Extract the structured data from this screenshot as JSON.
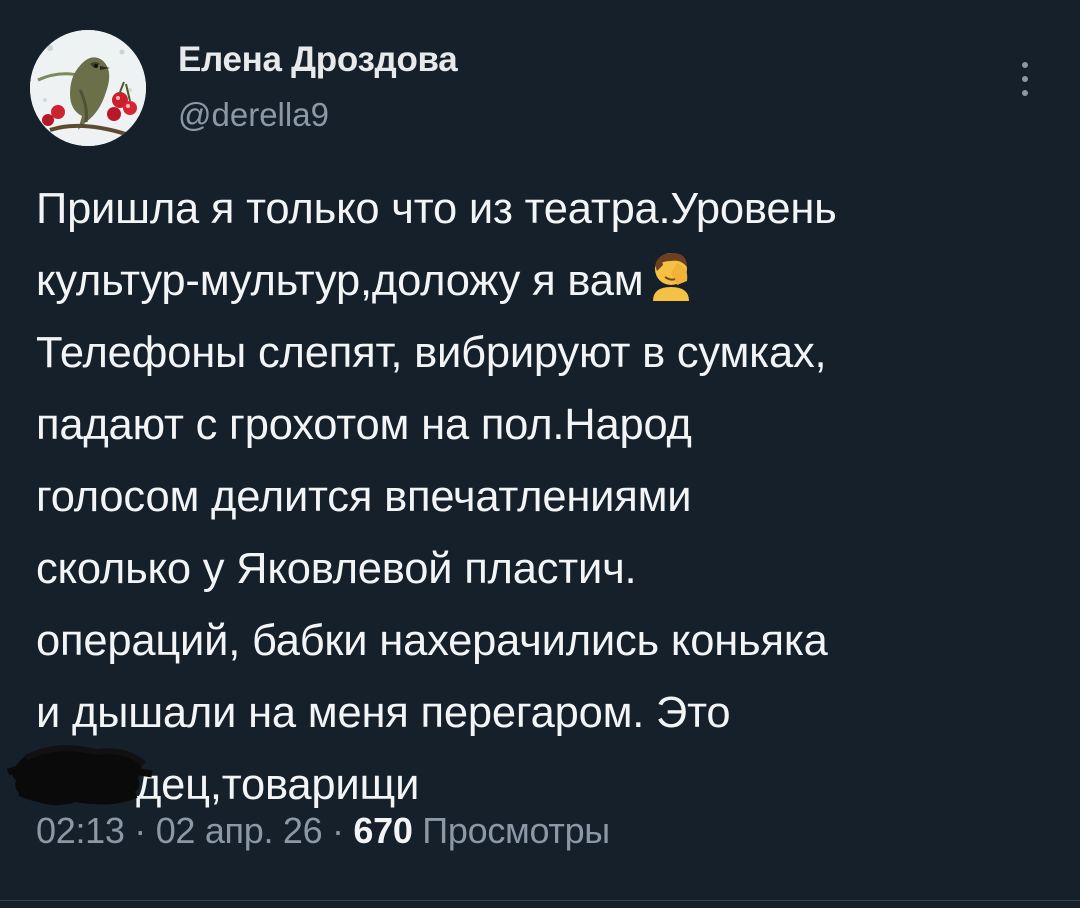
{
  "author": {
    "display_name": "Елена Дроздова",
    "handle": "@derella9"
  },
  "tweet": {
    "lines": [
      "Пришла я только что из театра.Уровень",
      "культур-мультур,доложу я вам",
      "Телефоны слепят, вибрируют в сумках,",
      "падают с грохотом на пол.Народ",
      "голосом делится впечатлениями",
      "сколько у Яковлевой пластич.",
      "операций, бабки нахерачились коньяка",
      "и дышали на меня перегаром. Это",
      "п**дец,товарищи"
    ],
    "visible_last_line": "дец,товарищи",
    "emoji": "facepalm-emoji"
  },
  "meta": {
    "time": "02:13",
    "sep1": " · ",
    "date": "02 апр. 26",
    "sep2": " · ",
    "views_count": "670",
    "views_label": " Просмотры"
  },
  "icons": {
    "more": "more-vertical-icon",
    "avatar": "bird-with-cherries-avatar"
  },
  "colors": {
    "background": "#15202b",
    "text": "#e7e9ea",
    "secondary": "#8b98a5",
    "divider": "#38444d"
  }
}
